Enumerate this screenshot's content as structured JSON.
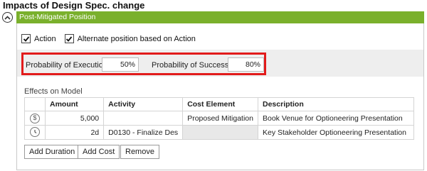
{
  "page": {
    "title": "Impacts of Design Spec. change",
    "section_header": "Post-Mitigated Position"
  },
  "options": {
    "action_label": "Action",
    "action_checked": true,
    "alternate_label": "Alternate position based on Action",
    "alternate_checked": true
  },
  "probabilities": {
    "execution_label": "Probability of Execution:",
    "execution_value": "50%",
    "success_label": "Probability of Success:",
    "success_value": "80%"
  },
  "effects": {
    "label": "Effects on Model",
    "columns": [
      "Amount",
      "Activity",
      "Cost Element",
      "Description"
    ],
    "rows": [
      {
        "icon": "dollar-icon",
        "amount": "5,000",
        "activity": "",
        "cost_element": "Proposed Mitigation",
        "description": "Book Venue for Optioneering Presentation"
      },
      {
        "icon": "duration-clock-icon",
        "amount": "2d",
        "activity": "D0130 - Finalize Des",
        "cost_element": "",
        "description": "Key Stakeholder Optioneering Presentation"
      }
    ]
  },
  "buttons": {
    "add_duration": "Add Duration",
    "add_cost": "Add Cost",
    "remove": "Remove"
  },
  "colors": {
    "section_bar": "#7ab02c",
    "highlight_border": "#e21b1b"
  }
}
